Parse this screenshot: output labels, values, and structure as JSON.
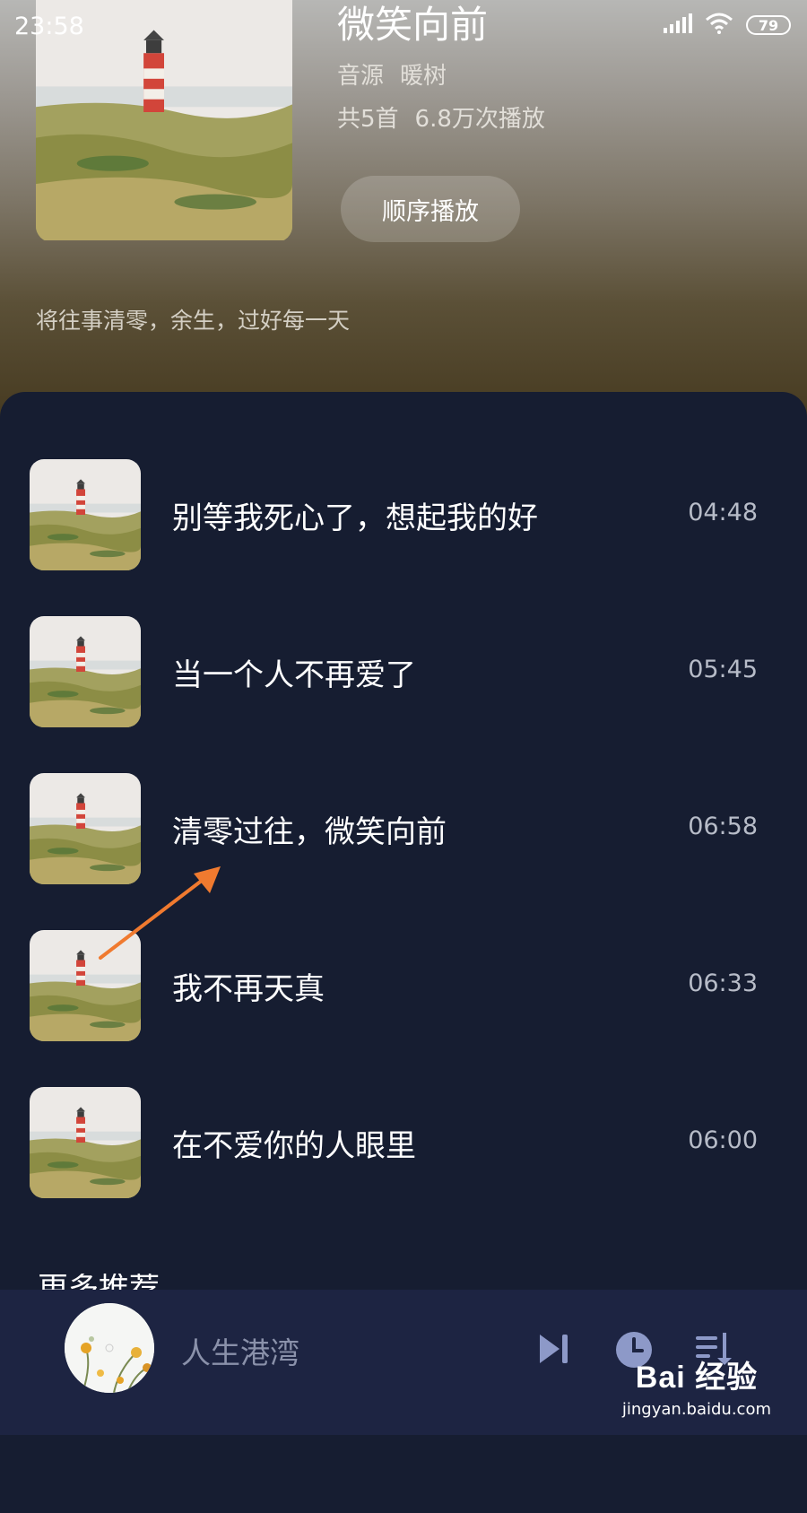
{
  "status_bar": {
    "time": "23:58",
    "battery": "79"
  },
  "album": {
    "title": "微笑向前",
    "source_label": "音源",
    "source_name": "暖树",
    "count": "共5首",
    "plays": "6.8万次播放",
    "play_mode_button": "顺序播放",
    "description": "将往事清零，余生，过好每一天"
  },
  "songs": [
    {
      "title": "别等我死心了，想起我的好",
      "duration": "04:48"
    },
    {
      "title": "当一个人不再爱了",
      "duration": "05:45"
    },
    {
      "title": "清零过往，微笑向前",
      "duration": "06:58"
    },
    {
      "title": "我不再天真",
      "duration": "06:33"
    },
    {
      "title": "在不爱你的人眼里",
      "duration": "06:00"
    }
  ],
  "section_peek": "更多推荐",
  "player": {
    "now_playing": "人生港湾"
  },
  "watermark": {
    "logo": "Bai 经验",
    "url": "jingyan.baidu.com"
  },
  "colors": {
    "panel_bg": "#161d31",
    "player_bg": "#1d2442",
    "annotation_arrow": "#f07a2f"
  }
}
